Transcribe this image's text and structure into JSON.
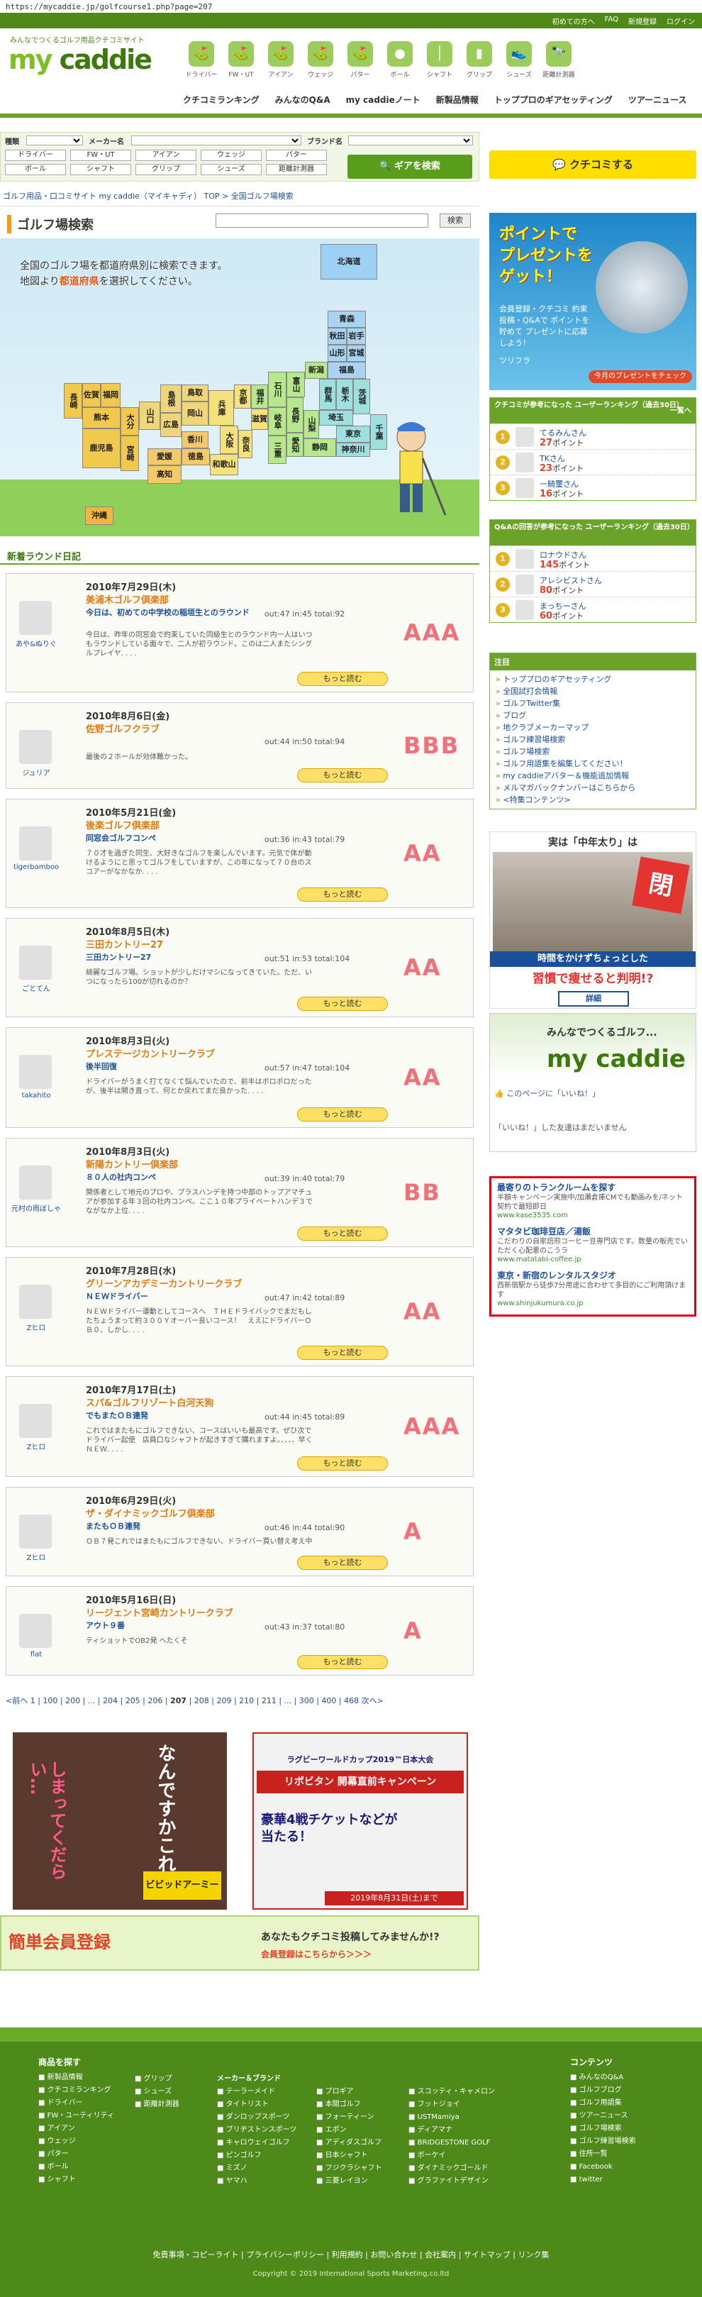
{
  "url": "https://mycaddie.jp/golfcourse1.php?page=207",
  "topbar": {
    "links": [
      "初めての方へ",
      "FAQ",
      "新規登録",
      "ログイン"
    ]
  },
  "logo": {
    "tagline": "みんなでつくるゴルフ用品クチコミサイト",
    "text_my": "my",
    "text_caddie": "caddie"
  },
  "categories": [
    {
      "label": "ドライバー",
      "icon": "driver-icon"
    },
    {
      "label": "FW・UT",
      "icon": "fairway-wood-icon"
    },
    {
      "label": "アイアン",
      "icon": "iron-icon"
    },
    {
      "label": "ウェッジ",
      "icon": "wedge-icon"
    },
    {
      "label": "パター",
      "icon": "putter-icon"
    },
    {
      "label": "ボール",
      "icon": "ball-icon"
    },
    {
      "label": "シャフト",
      "icon": "shaft-icon"
    },
    {
      "label": "グリップ",
      "icon": "grip-icon"
    },
    {
      "label": "シューズ",
      "icon": "shoes-icon"
    },
    {
      "label": "距離計測器",
      "icon": "rangefinder-icon"
    }
  ],
  "mainnav": [
    "クチコミランキング",
    "みんなのQ&A",
    "my caddieノート",
    "新製品情報",
    "トッププロのギアセッティング",
    "ツアーニュース"
  ],
  "search": {
    "label_type": "種類",
    "label_maker": "メーカー名",
    "label_brand": "ブランド名",
    "buttons": [
      "ドライバー",
      "FW・UT",
      "アイアン",
      "ウェッジ",
      "パター",
      "ボール",
      "シャフト",
      "グリップ",
      "シューズ",
      "距離計測器"
    ],
    "gear_button": "ギアを検索"
  },
  "kuchikomi_button": "クチコミする",
  "breadcrumb": "ゴルフ用品・口コミサイト my caddie（マイキャディ） TOP > 全国ゴルフ場検索",
  "course_search": {
    "title": "ゴルフ場検索",
    "search_button": "検索"
  },
  "map": {
    "hint_line1": "全国のゴルフ場を都道府県別に検索できます。",
    "hint_line2_a": "地図より",
    "hint_line2_b": "都道府県",
    "hint_line2_c": "を選択してください。",
    "prefectures": [
      "北海道",
      "青森",
      "秋田",
      "岩手",
      "山形",
      "宮城",
      "福島",
      "新潟",
      "群馬",
      "栃木",
      "茨城",
      "埼玉",
      "千葉",
      "東京",
      "神奈川",
      "富山",
      "石川",
      "福井",
      "長野",
      "山梨",
      "岐阜",
      "静岡",
      "愛知",
      "三重",
      "京都",
      "滋賀",
      "兵庫",
      "大阪",
      "奈良",
      "和歌山",
      "鳥取",
      "島根",
      "岡山",
      "広島",
      "山口",
      "香川",
      "愛媛",
      "徳島",
      "高知",
      "福岡",
      "佐賀",
      "長崎",
      "熊本",
      "大分",
      "宮崎",
      "鹿児島",
      "沖縄"
    ]
  },
  "diary_title": "新着ラウンド日記",
  "entries": [
    {
      "user": "あや&ぬりぐ",
      "date": "2010年7月29日(木)",
      "course": "美浦木ゴルフ倶楽部",
      "sub": "今日は、初めての中学校の稲垣生とのラウンド",
      "score": "out:47   in:45   total:92",
      "body": "今日は、昨年の同窓会で約束していた同級生とのラウンド内一人はいつもラウンドしている面々で、二人が初ラウンド。このは二人またシングルプレイヤ. . . .",
      "grade": "AAA",
      "more": "もっと読む"
    },
    {
      "user": "ジュリア",
      "date": "2010年8月6日(金)",
      "course": "佐野ゴルフクラブ",
      "sub": "",
      "score": "out:44   in:50   total:94",
      "body": "最後の２ホールが効体難かった。",
      "grade": "BBB",
      "more": "もっと読む"
    },
    {
      "user": "tigerbamboo",
      "date": "2010年5月21日(金)",
      "course": "後楽ゴルフ倶楽部",
      "sub": "同窓会ゴルフコンペ",
      "score": "out:36   in:43   total:79",
      "body": "７０才を過ぎた同生、大好きなゴルフを楽しんでいます。元気で体が動けるようにと思ってゴルフをしていますが、この年になって７０台のスコアーがなかなか. . . .",
      "grade": "AA",
      "more": "もっと読む"
    },
    {
      "user": "ごとてん",
      "date": "2010年8月5日(木)",
      "course": "三田カントリー27",
      "sub": "三田カントリー27",
      "score": "out:51   in:53   total:104",
      "body": "綺麗なゴルフ場。ショットが少しだけマシになってきていた。ただ、いつになったら100が切れるのか？",
      "grade": "AA",
      "more": "もっと読む"
    },
    {
      "user": "takahito",
      "date": "2010年8月3日(火)",
      "course": "プレステージカントリークラブ",
      "sub": "後半回復",
      "score": "out:57   in:47   total:104",
      "body": "ドライバーがうまく打てなくて悩んでいたので、前半はボロボロだったが、後半は開き直って、何とか戻れてまだ良かった. . . .",
      "grade": "AA",
      "more": "もっと読む"
    },
    {
      "user": "元村の雨ぼしゃ",
      "date": "2010年8月3日(火)",
      "course": "新陽カントリー倶楽部",
      "sub": "８０人の社内コンペ",
      "score": "out:39   in:40   total:79",
      "body": "関係者として地元のプロや、プラスハンデを持つ中部のトップアマチュアが参加する年３回の社内コンペ。ここ１０年プライベートハンデ３でながなか上位. . . .",
      "grade": "BB",
      "more": "もっと読む"
    },
    {
      "user": "Zヒロ",
      "date": "2010年7月28日(水)",
      "course": "グリーンアカデミーカントリークラブ",
      "sub": "ＮＥＷドライバー",
      "score": "out:47   in:42   total:89",
      "body": "ＮＥＷドライバー運動としてコースへ　ＴＨＥドライバックでまだもしたちょうまって約３００Ｙオーバー良いコース！　ええにドライバーＯＢ０、しかし. . . .",
      "grade": "AA",
      "more": "もっと読む"
    },
    {
      "user": "Zヒロ",
      "date": "2010年7月17日(土)",
      "course": "スパ&ゴルフリゾート白河天狗",
      "sub": "でもまたＯＢ連発",
      "score": "out:44   in:45   total:89",
      "body": "これではまたもにゴルフできない、コースはいいも最高です。ぜひ次でドライバー起使　店員口なシャフトが起きすぎて購れますよ。．．．．早くＮＥＷ. . . .",
      "grade": "AAA",
      "more": "もっと読む"
    },
    {
      "user": "Zヒロ",
      "date": "2010年6月29日(火)",
      "course": "ザ・ダイナミックゴルフ倶楽部",
      "sub": "またもＯＢ連発",
      "score": "out:46   in:44   total:90",
      "body": "ＯＢ７発これではまたもにゴルフできない、ドライバー買い替え考え中",
      "grade": "A",
      "more": "もっと読む"
    },
    {
      "user": "flat",
      "date": "2010年5月16日(日)",
      "course": "リージェント宮崎カントリークラブ",
      "sub": "アウト９番",
      "score": "out:43   in:37   total:80",
      "body": "ティショットでOB2発 へたくそ",
      "grade": "A",
      "more": "もっと読む"
    }
  ],
  "pager": {
    "prev": "<前へ",
    "pages_a": "1 | 100 | 200 | ... | 204 | 205 | 206 |",
    "current": "207",
    "pages_b": "| 208 | 209 | 210 | 211 | ... | 300 | 400 | 468",
    "next": "次へ>"
  },
  "banners": {
    "left_a": "なんですかこれ",
    "left_b": "しまってくだらい…",
    "left_c": "ビビッドアーミー",
    "right_a": "ラグビーワールドカップ2019™日本大会",
    "right_b": "リポビタン 開幕直前キャンペーン",
    "right_c": "豪華4戦チケットなどが当たる！",
    "right_d": "2019年8月31日(土)まで"
  },
  "register_banner": {
    "left": "簡単会員登録",
    "right1": "あなたもクチコミ投稿してみませんか!?",
    "right2": "会員登録はこちらから＞＞＞"
  },
  "ad1": {
    "title1": "ポイントで",
    "title2": "プレゼントを",
    "title3": "ゲット！",
    "desc": "会員登録・クチコミ 約束投稿・Q&Aで ポイントを貯めて プレゼントに応募しよう！",
    "product": "ツリフラ",
    "button": "今月のプレゼントをチェック"
  },
  "ranking1": {
    "title": "クチコミが参考になった ユーザーランキング（過去30日）",
    "more": "一覧へ",
    "rows": [
      {
        "rank": "1",
        "name": "てるみんさん",
        "points": "27",
        "unit": "ポイント"
      },
      {
        "rank": "2",
        "name": "TKさん",
        "points": "23",
        "unit": "ポイント"
      },
      {
        "rank": "3",
        "name": "一騎璽さん",
        "points": "16",
        "unit": "ポイント"
      }
    ]
  },
  "ranking2": {
    "title": "Q&Aの回答が参考になった ユーザーランキング（過去30日）",
    "rows": [
      {
        "rank": "1",
        "name": "ロナウドさん",
        "points": "145",
        "unit": "ポイント"
      },
      {
        "rank": "2",
        "name": "アレシピストさん",
        "points": "80",
        "unit": "ポイント"
      },
      {
        "rank": "3",
        "name": "まっちーさん",
        "points": "60",
        "unit": "ポイント"
      }
    ]
  },
  "notice": {
    "title": "注目",
    "items": [
      "トッププロのギアセッティング",
      "全国試打会情報",
      "ゴルフTwitter集",
      "ブログ",
      "地クラブメーカーマップ",
      "ゴルフ練習場検索",
      "ゴルフ場検索",
      "ゴルフ用語集を編集してください！",
      "my caddieアバター＆機能追加情報",
      "メルマガバックナンバーはこちらから",
      "<特集コンテンツ>"
    ]
  },
  "ad2": {
    "title": "実は「中年太り」は",
    "stamp": "閉",
    "caption": "時間をかけずちょっとした",
    "big": "習慣で痩せると判明!?",
    "button": "詳細"
  },
  "fb": {
    "title": "みんなでつくるゴルフ...",
    "logo": "my caddie",
    "like": "このページに「いいね！」",
    "msg": "「いいね！」した友達はまだいません"
  },
  "ad3": [
    {
      "h": "最寄りのトランクルームを探す",
      "d": "半額キャンペーン実施中/加瀬倉庫CMでも動画みを/ネット契約で最短即日",
      "u": "www.kase3535.com"
    },
    {
      "h": "マタタビ珈琲豆店／湯飯",
      "d": "こだわりの自家焙煎コーヒー豆専門店です。数量の販売でいただく心配悪のこうラ",
      "u": "www.matatabi-coffee.jp"
    },
    {
      "h": "東京・新宿のレンタルスタジオ",
      "d": "西新宿駅から徒歩7分用途に合わせて多目的にご利用頂けます",
      "u": "www.shinjukumura.co.jp"
    }
  ],
  "footer": {
    "col1_title": "商品を探す",
    "col1": [
      "新製品情報",
      "クチコミランキング",
      "ドライバー",
      "FW・ユーティリティ",
      "アイアン",
      "ウェッジ",
      "パター",
      "ボール",
      "シャフト"
    ],
    "col2": [
      "グリップ",
      "シューズ",
      "距離計測器"
    ],
    "col3_title": "メーカー＆ブランド",
    "col3": [
      "テーラーメイド",
      "タイトリスト",
      "ダンロップスポーツ",
      "ブリヂストンスポーツ",
      "キャロウェイゴルフ",
      "ピンゴルフ",
      "ミズノ",
      "ヤマハ"
    ],
    "col4": [
      "プロギア",
      "本間ゴルフ",
      "フォーティーン",
      "エポン",
      "アディダスゴルフ",
      "日本シャフト",
      "フジクラシャフト",
      "三菱レイヨン"
    ],
    "col5": [
      "スコッティ・キャメロン",
      "フットジョイ",
      "USTMamiya",
      "ディアマナ",
      "BRIDGESTONE GOLF",
      "ボーケイ",
      "ダイナミックゴールド",
      "グラファイトデザイン"
    ],
    "col6_title": "コンテンツ",
    "col6": [
      "みんなのQ&A",
      "ゴルフブログ",
      "ゴルフ用語集",
      "ツアーニュース",
      "ゴルフ場検索",
      "ゴルフ練習場検索",
      "住所一覧",
      "Facebook",
      "twitter"
    ],
    "bottom": "免責事項・コピーライト | プライバシーポリシー | 利用規約 | お問い合わせ | 会社案内 | サイトマップ | リンク集",
    "copyright": "Copyright © 2019 International Sports Marketing,co.ltd"
  },
  "colors": {
    "brand_green": "#4f8a16",
    "accent_orange": "#e07a10",
    "grade_pink": "#f2707a",
    "link_blue": "#1a4f9c"
  }
}
